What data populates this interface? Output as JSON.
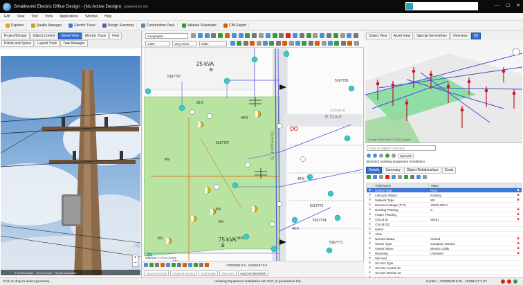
{
  "window": {
    "title": "Smallworld Electric Office Design - (No Active Design)",
    "powered_by": "powered by GE"
  },
  "menu": [
    "Edit",
    "View",
    "Tool",
    "Tools",
    "Applications",
    "Window",
    "Help"
  ],
  "toolbar": [
    {
      "label": "Explorer",
      "color": "#e8a020"
    },
    {
      "label": "Quality Manager",
      "color": "#c8a030"
    },
    {
      "label": "Electric Trace",
      "color": "#3a7bd5"
    },
    {
      "label": "Design Summary",
      "color": "#7a4fb5"
    },
    {
      "label": "Construction Pack",
      "color": "#4a90c0"
    },
    {
      "label": "Validate Schematic",
      "color": "#2ca02c"
    },
    {
      "label": "CIM Export",
      "color": "#d95f02"
    }
  ],
  "left_tabs": {
    "row1": [
      "Project/Design",
      "Object Control",
      "Street View",
      "Electric Trace",
      "Find",
      "Points and Spans"
    ],
    "row2": [
      "Layout Tools",
      "Task Manager"
    ],
    "active": "Street View"
  },
  "streetview": {
    "footer": [
      "© 2018 Google",
      "Terms of Use",
      "Report a problem"
    ]
  },
  "map": {
    "view_select": "Geographic",
    "scale": "1:597",
    "zoom_mode": "Very Close",
    "layer": "Miller",
    "labels": {
      "kva_top": "25 kVA",
      "kva_top_b": "B",
      "kva_bottom": "75 kVA",
      "kva_bottom_b": "B",
      "parcel_1": "5167797",
      "parcel_2": "5167793",
      "parcel_3": "5167767",
      "parcel_4": "5167772",
      "parcel_5": "5167774",
      "parcel_6": "5167771",
      "span_1": "35-5",
      "span_2": "40-5",
      "span_3": "40-5",
      "mv_1": "MV",
      "mv_2": "MV",
      "mv_3": "MV",
      "mv_4": "MV",
      "mv_5": "MV",
      "hps_1": "HPS",
      "hps_2": "HPS",
      "street_1": "Greenwich St",
      "street_2": "E Court",
      "street_3": "E Court St"
    },
    "attribution": "Map data © 2018 Google"
  },
  "map_bottom": {
    "fields": [
      "Segment length",
      "Segment bearing",
      "Total length",
      "Total area"
    ],
    "coords": "-27820993 2.5 , 16366157 9.0",
    "cad": "AutoCAD RealDWG"
  },
  "right_tabs": [
    "Object View",
    "Asset View",
    "Special Geometries",
    "Overview",
    "3D"
  ],
  "view3d_attribution": "Google Earth View © 2018 Google",
  "object_panel": {
    "select_placeholder": "Enter an Object Collection",
    "specials": "Specials",
    "title": "[Electric] Isolating Equipment Installation",
    "detail_tabs": [
      "Details",
      "Summary",
      "Object Relationships",
      "Costs"
    ],
    "columns": [
      "Field name",
      "Value"
    ],
    "rows": [
      {
        "name": "Device Type",
        "value": "Fuse",
        "flag": "■",
        "selected": true
      },
      {
        "name": "Lifecycle Status",
        "value": "Existing",
        "flag": "■"
      },
      {
        "name": "Network Type",
        "value": "MV",
        "flag": "■"
      },
      {
        "name": "Nominal Voltage (P-P)",
        "value": "13200,000 V",
        "flag": ""
      },
      {
        "name": "Existing Phasing",
        "value": "C",
        "flag": "■"
      },
      {
        "name": "Future Phasing",
        "value": "",
        "flag": "■"
      },
      {
        "name": "Circuit ID",
        "value": "50251",
        "flag": "■"
      },
      {
        "name": "Circuit ID2",
        "value": "",
        "flag": ""
      },
      {
        "name": "Name",
        "value": "",
        "flag": ""
      },
      {
        "name": "Alias",
        "value": "",
        "flag": ""
      },
      {
        "name": "Normal Status",
        "value": "Closed",
        "flag": "■"
      },
      {
        "name": "Owner Type",
        "value": "Company Owned",
        "flag": "■"
      },
      {
        "name": "Owner Name",
        "value": "Electric Utility",
        "flag": "■"
      },
      {
        "name": "Mounting",
        "value": "Unknown",
        "flag": "■"
      },
      {
        "name": "Mirrored",
        "value": "",
        "flag": ""
      },
      {
        "name": "SCADA Type",
        "value": "",
        "flag": ""
      },
      {
        "name": "SCADA Control ID",
        "value": "",
        "flag": ""
      },
      {
        "name": "SCADA Monitor ID",
        "value": "",
        "flag": ""
      },
      {
        "name": "Location Description",
        "value": "",
        "flag": ""
      },
      {
        "name": "Remarks",
        "value": "",
        "flag": ""
      },
      {
        "name": "Connector",
        "value": "✔",
        "flag": ""
      },
      {
        "name": "Annotation",
        "value": "",
        "flag": ""
      }
    ]
  },
  "status": {
    "hint": "Click or drag to select geometry",
    "selection": "Isolating Equipment Installation MV Pin1 (2 geometries hit)",
    "centre": "Centre : -27820848 9.05 , 16366117 2.37"
  },
  "colors": {
    "accent": "#2e6fd1",
    "parcel_green": "#b9e3a1",
    "wire_blue": "#4a56d6",
    "pole_teal": "#3ec7c7"
  }
}
